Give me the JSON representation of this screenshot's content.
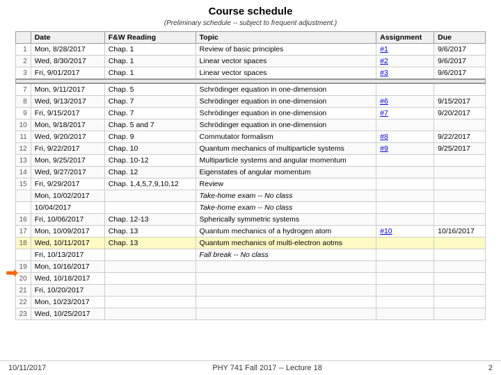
{
  "title": "Course schedule",
  "subtitle": "(Preliminary schedule -- subject to frequent adjustment.)",
  "table": {
    "headers": [
      "",
      "Date",
      "F&W Reading",
      "Topic",
      "Assignment",
      "Due"
    ],
    "rows": [
      {
        "num": "1",
        "date": "Mon, 8/28/2017",
        "reading": "Chap. 1",
        "topic": "Review of basic principles",
        "assignment": "#1",
        "due": "9/6/2017",
        "link": true,
        "highlight": false,
        "italic": false
      },
      {
        "num": "2",
        "date": "Wed, 8/30/2017",
        "reading": "Chap. 1",
        "topic": "Linear vector spaces",
        "assignment": "#2",
        "due": "9/6/2017",
        "link": true,
        "highlight": false,
        "italic": false
      },
      {
        "num": "3",
        "date": "Fri, 9/01/2017",
        "reading": "Chap. 1",
        "topic": "Linear vector spaces",
        "assignment": "#3",
        "due": "9/6/2017",
        "link": true,
        "highlight": false,
        "italic": false
      },
      {
        "num": "",
        "date": "",
        "reading": "",
        "topic": "",
        "assignment": "",
        "due": "",
        "link": false,
        "highlight": false,
        "italic": false,
        "sep": true
      },
      {
        "num": "7",
        "date": "Mon, 9/11/2017",
        "reading": "Chap. 5",
        "topic": "Schrödinger equation in one-dimension",
        "assignment": "",
        "due": "",
        "link": false,
        "highlight": false,
        "italic": false
      },
      {
        "num": "8",
        "date": "Wed, 9/13/2017",
        "reading": "Chap. 7",
        "topic": "Schrödinger equation in one-dimension",
        "assignment": "#6",
        "due": "9/15/2017",
        "link": true,
        "highlight": false,
        "italic": false
      },
      {
        "num": "9",
        "date": "Fri, 9/15/2017",
        "reading": "Chap. 7",
        "topic": "Schrödinger equation in one-dimension",
        "assignment": "#7",
        "due": "9/20/2017",
        "link": true,
        "highlight": false,
        "italic": false
      },
      {
        "num": "10",
        "date": "Mon, 9/18/2017",
        "reading": "Chap. 5 and 7",
        "topic": "Schrödinger equation in one-dimension",
        "assignment": "",
        "due": "",
        "link": false,
        "highlight": false,
        "italic": false
      },
      {
        "num": "11",
        "date": "Wed, 9/20/2017",
        "reading": "Chap. 9",
        "topic": "Commutator formalism",
        "assignment": "#8",
        "due": "9/22/2017",
        "link": true,
        "highlight": false,
        "italic": false
      },
      {
        "num": "12",
        "date": "Fri, 9/22/2017",
        "reading": "Chap. 10",
        "topic": "Quantum mechanics of multiparticle systems",
        "assignment": "#9",
        "due": "9/25/2017",
        "link": true,
        "highlight": false,
        "italic": false
      },
      {
        "num": "13",
        "date": "Mon, 9/25/2017",
        "reading": "Chap. 10-12",
        "topic": "Multiparticle systems and angular momentum",
        "assignment": "",
        "due": "",
        "link": false,
        "highlight": false,
        "italic": false
      },
      {
        "num": "14",
        "date": "Wed, 9/27/2017",
        "reading": "Chap. 12",
        "topic": "Eigenstates of angular momentum",
        "assignment": "",
        "due": "",
        "link": false,
        "highlight": false,
        "italic": false
      },
      {
        "num": "15",
        "date": "Fri, 9/29/2017",
        "reading": "Chap. 1,4,5,7,9,10,12",
        "topic": "Review",
        "assignment": "",
        "due": "",
        "link": false,
        "highlight": false,
        "italic": false
      },
      {
        "num": "",
        "date": "Mon, 10/02/2017",
        "reading": "",
        "topic": "Take-home exam -- No class",
        "assignment": "",
        "due": "",
        "link": false,
        "highlight": false,
        "italic": true
      },
      {
        "num": "",
        "date": "10/04/2017",
        "reading": "",
        "topic": "Take-home exam -- No class",
        "assignment": "",
        "due": "",
        "link": false,
        "highlight": false,
        "italic": true
      },
      {
        "num": "16",
        "date": "Fri, 10/06/2017",
        "reading": "Chap. 12-13",
        "topic": "Spherically symmetric systems",
        "assignment": "",
        "due": "",
        "link": false,
        "highlight": false,
        "italic": false
      },
      {
        "num": "17",
        "date": "Mon, 10/09/2017",
        "reading": "Chap. 13",
        "topic": "Quantum mechanics of a hydrogen atom",
        "assignment": "#10",
        "due": "10/16/2017",
        "link": true,
        "highlight": false,
        "italic": false
      },
      {
        "num": "18",
        "date": "Wed, 10/11/2017",
        "reading": "Chap. 13",
        "topic": "Quantum mechanics of multi-electron aotms",
        "assignment": "",
        "due": "",
        "link": false,
        "highlight": true,
        "italic": false
      },
      {
        "num": "",
        "date": "Fri, 10/13/2017",
        "reading": "",
        "topic": "Fall break -- No class",
        "assignment": "",
        "due": "",
        "link": false,
        "highlight": false,
        "italic": true
      },
      {
        "num": "19",
        "date": "Mon, 10/16/2017",
        "reading": "",
        "topic": "",
        "assignment": "",
        "due": "",
        "link": false,
        "highlight": false,
        "italic": false
      },
      {
        "num": "20",
        "date": "Wed, 10/18/2017",
        "reading": "",
        "topic": "",
        "assignment": "",
        "due": "",
        "link": false,
        "highlight": false,
        "italic": false
      },
      {
        "num": "21",
        "date": "Fri, 10/20/2017",
        "reading": "",
        "topic": "",
        "assignment": "",
        "due": "",
        "link": false,
        "highlight": false,
        "italic": false
      },
      {
        "num": "22",
        "date": "Mon, 10/23/2017",
        "reading": "",
        "topic": "",
        "assignment": "",
        "due": "",
        "link": false,
        "highlight": false,
        "italic": false
      },
      {
        "num": "23",
        "date": "Wed, 10/25/2017",
        "reading": "",
        "topic": "",
        "assignment": "",
        "due": "",
        "link": false,
        "highlight": false,
        "italic": false
      }
    ]
  },
  "footer": {
    "left": "10/11/2017",
    "center": "PHY 741  Fall 2017 -- Lecture 18",
    "right": "2"
  }
}
